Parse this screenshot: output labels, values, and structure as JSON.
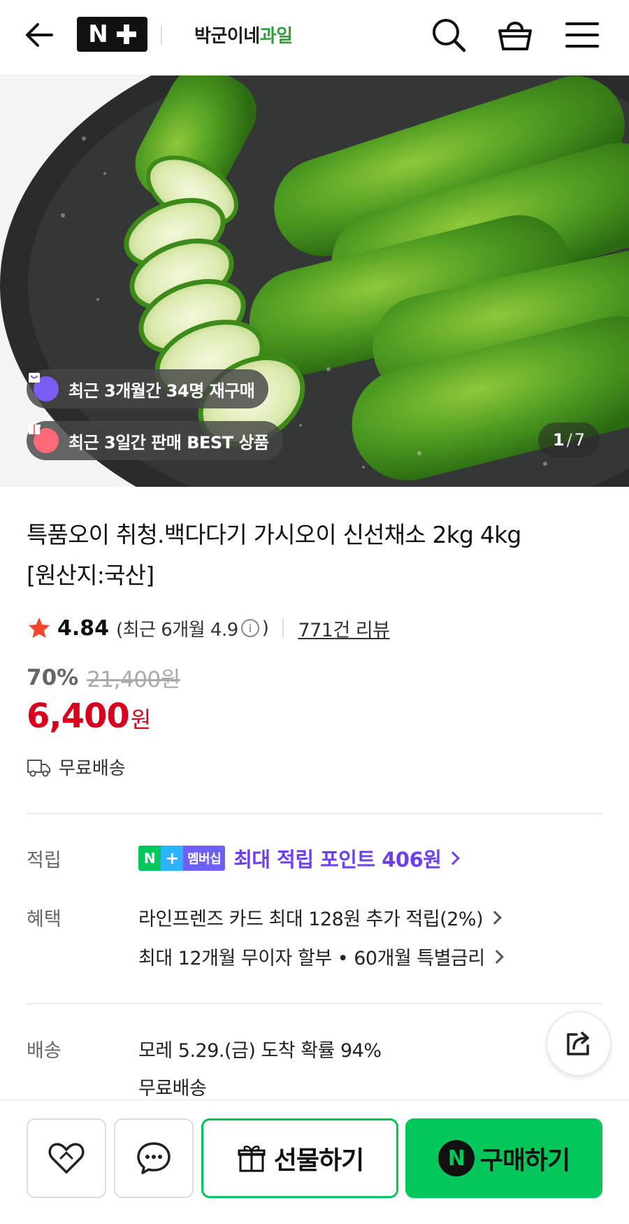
{
  "header": {
    "logo": "N+",
    "store_name_main": "박군이네",
    "store_name_accent": "과일"
  },
  "hero": {
    "badge_repurchase": "최근 3개월간 34명 재구매",
    "badge_best": "최근 3일간 판매 BEST 상품",
    "image_index": "1",
    "image_total": "7"
  },
  "product": {
    "title_line1": "특품오이 취청.백다다기 가시오이 신선채소 2kg 4kg",
    "title_line2": "[원산지:국산]",
    "rating": "4.84",
    "recent_rating_prefix": "(최근 6개월 4.9",
    "recent_rating_suffix": ")",
    "info_symbol": "i",
    "review_count": "771건 리뷰",
    "discount_rate": "70%",
    "original_price": "21,400원",
    "price": "6,400",
    "price_unit": "원",
    "shipping": "무료배송"
  },
  "points": {
    "label": "적립",
    "badge_n": "N",
    "badge_plus": "+",
    "badge_text": "멤버십",
    "text": "최대 적립 포인트 406원"
  },
  "benefits": {
    "label": "혜택",
    "line1": "라인프렌즈 카드 최대 128원 추가 적립(2%)",
    "line2": "최대 12개월 무이자 할부 • 60개월 특별금리"
  },
  "delivery": {
    "label": "배송",
    "line1": "모레 5.29.(금) 도착 확률 94%",
    "line2": "무료배송"
  },
  "bottom_bar": {
    "gift_label": "선물하기",
    "buy_label": "구매하기",
    "npay_symbol": "N"
  },
  "colors": {
    "price_red": "#d7001f",
    "naver_green": "#03c75a",
    "points_purple": "#6e3ff0",
    "star_red": "#f0462d"
  }
}
